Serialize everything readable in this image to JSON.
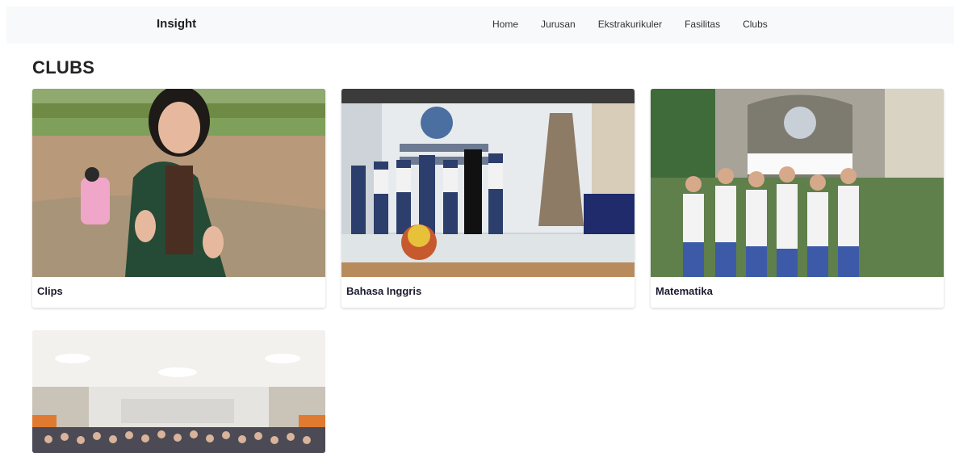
{
  "navbar": {
    "brand": "Insight",
    "links": [
      "Home",
      "Jurusan",
      "Ekstrakurikuler",
      "Fasilitas",
      "Clubs"
    ]
  },
  "page": {
    "title": "CLUBS"
  },
  "cards": [
    {
      "title": "Clips",
      "image": "girl-speaking-on-field-photo"
    },
    {
      "title": "Bahasa Inggris",
      "image": "english-competition-stage-photo"
    },
    {
      "title": "Matematika",
      "image": "students-group-photo"
    },
    {
      "title": "",
      "image": "auditorium-crowd-photo"
    }
  ],
  "colors": {
    "navbar_bg": "#f8f9fa",
    "title_text": "#1b1b2e"
  }
}
